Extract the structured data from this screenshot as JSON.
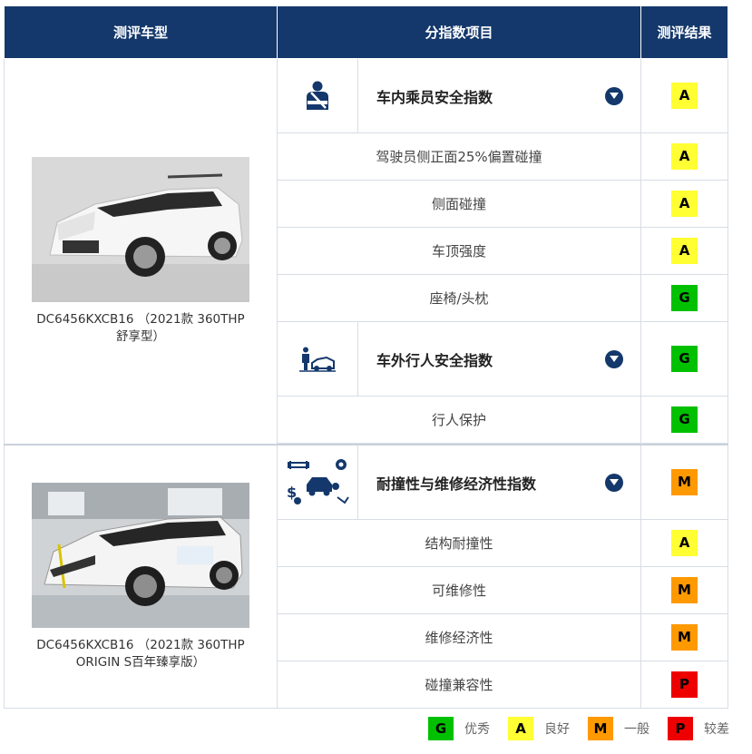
{
  "colors": {
    "header_bg": "#14386b",
    "G": "#00c000",
    "A": "#ffff33",
    "M": "#ff9900",
    "P": "#ee0000",
    "border": "#d7dde5"
  },
  "header": {
    "col_model": "测评车型",
    "col_items": "分指数项目",
    "col_result": "测评结果"
  },
  "cars": [
    {
      "name": "DC6456KXCB16 （2021款 360THP 舒享型）",
      "photo": "car-photo-white-suv"
    },
    {
      "name": "DC6456KXCB16 （2021款 360THP ORIGIN S百年臻享版）",
      "photo": "car-photo-crash-test-suv"
    }
  ],
  "categories": [
    {
      "label": "车内乘员安全指数",
      "icon": "seatbelt-occupant-icon",
      "rating": "A",
      "items": [
        {
          "label": "驾驶员侧正面25%偏置碰撞",
          "rating": "A"
        },
        {
          "label": "侧面碰撞",
          "rating": "A"
        },
        {
          "label": "车顶强度",
          "rating": "A"
        },
        {
          "label": "座椅/头枕",
          "rating": "G"
        }
      ]
    },
    {
      "label": "车外行人安全指数",
      "icon": "pedestrian-car-icon",
      "rating": "G",
      "items": [
        {
          "label": "行人保护",
          "rating": "G"
        }
      ]
    },
    {
      "label": "耐撞性与维修经济性指数",
      "icon": "repair-economy-icon",
      "rating": "M",
      "items": [
        {
          "label": "结构耐撞性",
          "rating": "A"
        },
        {
          "label": "可维修性",
          "rating": "M"
        },
        {
          "label": "维修经济性",
          "rating": "M"
        },
        {
          "label": "碰撞兼容性",
          "rating": "P"
        }
      ]
    }
  ],
  "legend": [
    {
      "letter": "G",
      "text": "优秀"
    },
    {
      "letter": "A",
      "text": "良好"
    },
    {
      "letter": "M",
      "text": "一般"
    },
    {
      "letter": "P",
      "text": "较差"
    }
  ]
}
